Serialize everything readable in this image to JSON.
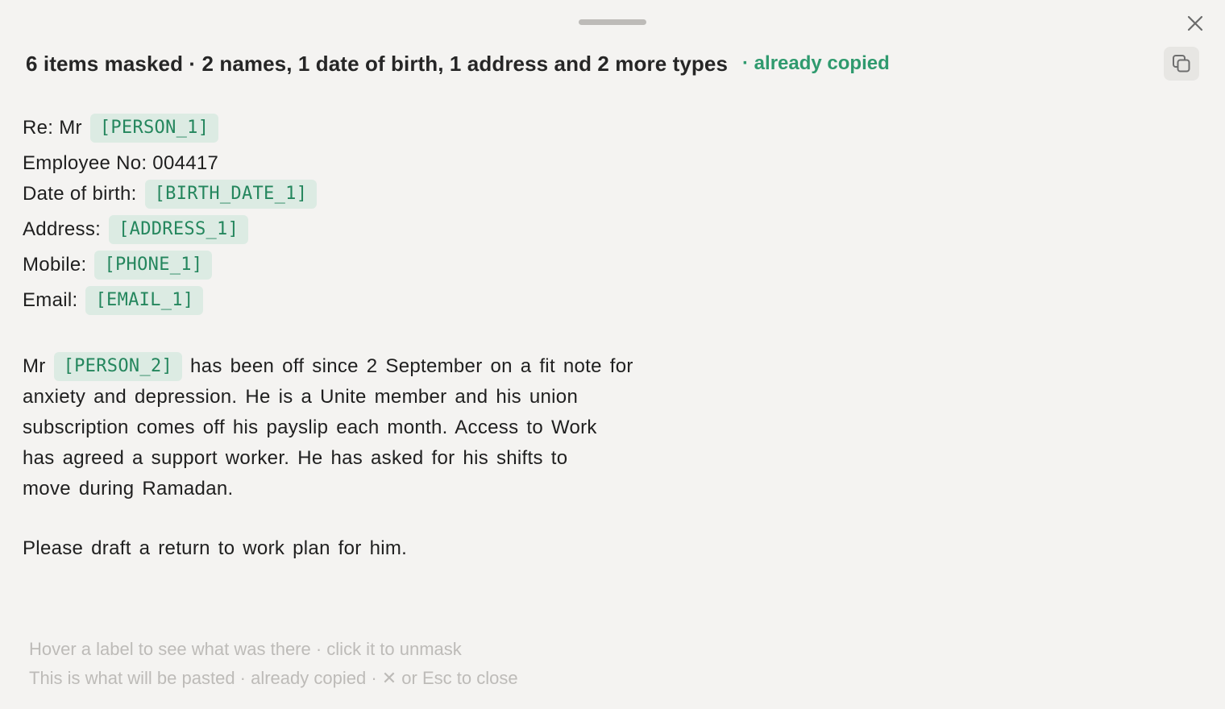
{
  "window": {
    "close_icon": "close-icon",
    "copy_icon": "copy-icon",
    "drag_handle": "drag-handle"
  },
  "summary": {
    "text": "6 items masked · 2 names, 1 date of birth, 1 address and 2 more types",
    "status": "· already copied",
    "status_color": "#2f9a6e"
  },
  "header_fields": [
    {
      "label": "Re: Mr",
      "tag": "[PERSON_1]"
    },
    {
      "label": "Employee No: 004417",
      "tag": null
    },
    {
      "label": "Date of birth:",
      "tag": "[BIRTH_DATE_1]"
    },
    {
      "label": "Address:",
      "tag": "[ADDRESS_1]"
    },
    {
      "label": "Mobile:",
      "tag": "[PHONE_1]"
    },
    {
      "label": "Email:",
      "tag": "[EMAIL_1]"
    }
  ],
  "body": {
    "prefix": "Mr",
    "person_tag": "[PERSON_2]",
    "line1_rest": "has been off since 2 September on a fit note for",
    "line2": "anxiety and depression. He is a Unite member and his union",
    "line3": "subscription comes off his payslip each month. Access to Work",
    "line4": "has agreed a support worker. He has asked for his shifts to",
    "line5": "move during Ramadan.",
    "final": "Please draft a return to work plan for him."
  },
  "footer": {
    "hint": "Hover a label to see what was there · click it to unmask",
    "note": "This is what will be pasted · already copied · ✕ or Esc to close"
  },
  "colors": {
    "background": "#f4f3f1",
    "tag_bg": "#dcebe3",
    "tag_text": "#24865d",
    "muted": "#bdbbb8"
  }
}
